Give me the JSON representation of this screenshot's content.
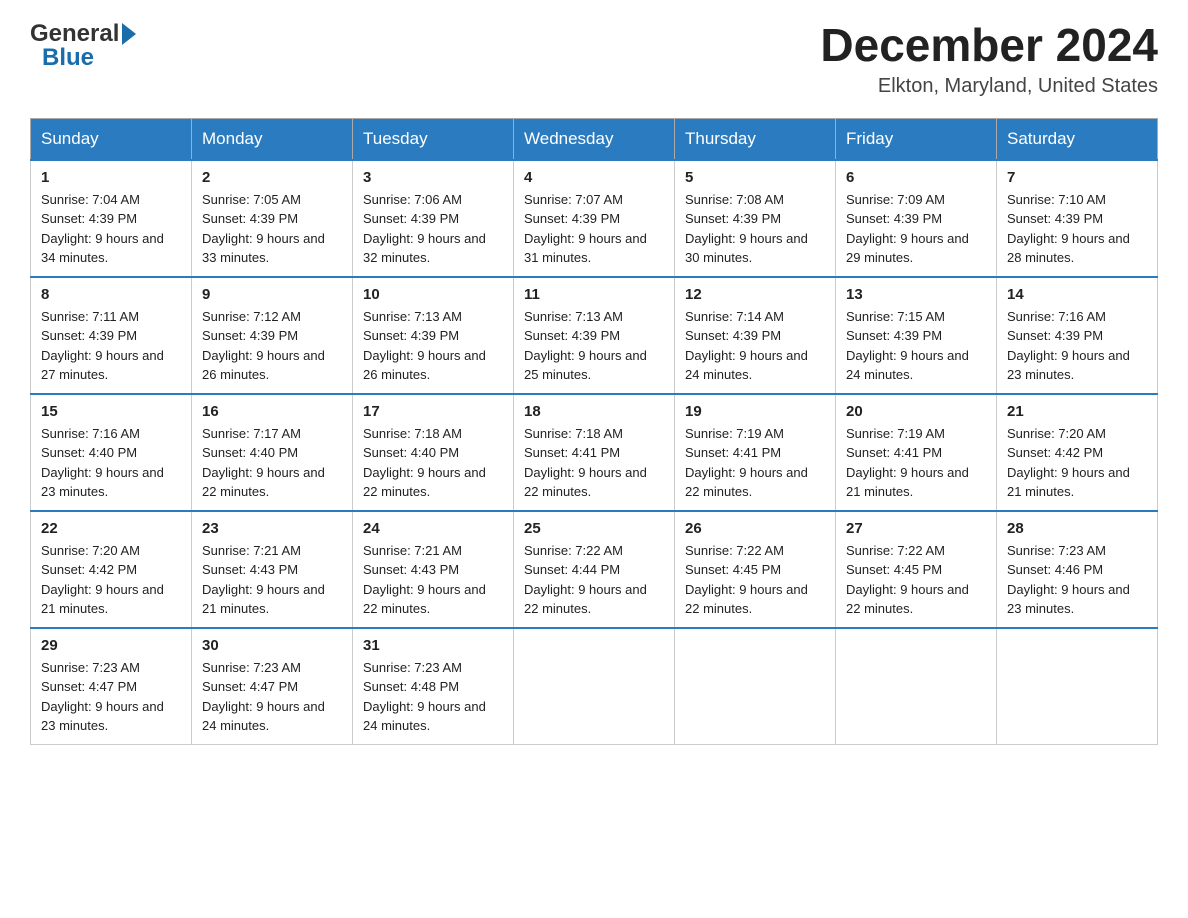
{
  "header": {
    "logo_general": "General",
    "logo_blue": "Blue",
    "month": "December 2024",
    "location": "Elkton, Maryland, United States"
  },
  "days_of_week": [
    "Sunday",
    "Monday",
    "Tuesday",
    "Wednesday",
    "Thursday",
    "Friday",
    "Saturday"
  ],
  "weeks": [
    [
      {
        "num": "1",
        "sunrise": "7:04 AM",
        "sunset": "4:39 PM",
        "daylight": "9 hours and 34 minutes."
      },
      {
        "num": "2",
        "sunrise": "7:05 AM",
        "sunset": "4:39 PM",
        "daylight": "9 hours and 33 minutes."
      },
      {
        "num": "3",
        "sunrise": "7:06 AM",
        "sunset": "4:39 PM",
        "daylight": "9 hours and 32 minutes."
      },
      {
        "num": "4",
        "sunrise": "7:07 AM",
        "sunset": "4:39 PM",
        "daylight": "9 hours and 31 minutes."
      },
      {
        "num": "5",
        "sunrise": "7:08 AM",
        "sunset": "4:39 PM",
        "daylight": "9 hours and 30 minutes."
      },
      {
        "num": "6",
        "sunrise": "7:09 AM",
        "sunset": "4:39 PM",
        "daylight": "9 hours and 29 minutes."
      },
      {
        "num": "7",
        "sunrise": "7:10 AM",
        "sunset": "4:39 PM",
        "daylight": "9 hours and 28 minutes."
      }
    ],
    [
      {
        "num": "8",
        "sunrise": "7:11 AM",
        "sunset": "4:39 PM",
        "daylight": "9 hours and 27 minutes."
      },
      {
        "num": "9",
        "sunrise": "7:12 AM",
        "sunset": "4:39 PM",
        "daylight": "9 hours and 26 minutes."
      },
      {
        "num": "10",
        "sunrise": "7:13 AM",
        "sunset": "4:39 PM",
        "daylight": "9 hours and 26 minutes."
      },
      {
        "num": "11",
        "sunrise": "7:13 AM",
        "sunset": "4:39 PM",
        "daylight": "9 hours and 25 minutes."
      },
      {
        "num": "12",
        "sunrise": "7:14 AM",
        "sunset": "4:39 PM",
        "daylight": "9 hours and 24 minutes."
      },
      {
        "num": "13",
        "sunrise": "7:15 AM",
        "sunset": "4:39 PM",
        "daylight": "9 hours and 24 minutes."
      },
      {
        "num": "14",
        "sunrise": "7:16 AM",
        "sunset": "4:39 PM",
        "daylight": "9 hours and 23 minutes."
      }
    ],
    [
      {
        "num": "15",
        "sunrise": "7:16 AM",
        "sunset": "4:40 PM",
        "daylight": "9 hours and 23 minutes."
      },
      {
        "num": "16",
        "sunrise": "7:17 AM",
        "sunset": "4:40 PM",
        "daylight": "9 hours and 22 minutes."
      },
      {
        "num": "17",
        "sunrise": "7:18 AM",
        "sunset": "4:40 PM",
        "daylight": "9 hours and 22 minutes."
      },
      {
        "num": "18",
        "sunrise": "7:18 AM",
        "sunset": "4:41 PM",
        "daylight": "9 hours and 22 minutes."
      },
      {
        "num": "19",
        "sunrise": "7:19 AM",
        "sunset": "4:41 PM",
        "daylight": "9 hours and 22 minutes."
      },
      {
        "num": "20",
        "sunrise": "7:19 AM",
        "sunset": "4:41 PM",
        "daylight": "9 hours and 21 minutes."
      },
      {
        "num": "21",
        "sunrise": "7:20 AM",
        "sunset": "4:42 PM",
        "daylight": "9 hours and 21 minutes."
      }
    ],
    [
      {
        "num": "22",
        "sunrise": "7:20 AM",
        "sunset": "4:42 PM",
        "daylight": "9 hours and 21 minutes."
      },
      {
        "num": "23",
        "sunrise": "7:21 AM",
        "sunset": "4:43 PM",
        "daylight": "9 hours and 21 minutes."
      },
      {
        "num": "24",
        "sunrise": "7:21 AM",
        "sunset": "4:43 PM",
        "daylight": "9 hours and 22 minutes."
      },
      {
        "num": "25",
        "sunrise": "7:22 AM",
        "sunset": "4:44 PM",
        "daylight": "9 hours and 22 minutes."
      },
      {
        "num": "26",
        "sunrise": "7:22 AM",
        "sunset": "4:45 PM",
        "daylight": "9 hours and 22 minutes."
      },
      {
        "num": "27",
        "sunrise": "7:22 AM",
        "sunset": "4:45 PM",
        "daylight": "9 hours and 22 minutes."
      },
      {
        "num": "28",
        "sunrise": "7:23 AM",
        "sunset": "4:46 PM",
        "daylight": "9 hours and 23 minutes."
      }
    ],
    [
      {
        "num": "29",
        "sunrise": "7:23 AM",
        "sunset": "4:47 PM",
        "daylight": "9 hours and 23 minutes."
      },
      {
        "num": "30",
        "sunrise": "7:23 AM",
        "sunset": "4:47 PM",
        "daylight": "9 hours and 24 minutes."
      },
      {
        "num": "31",
        "sunrise": "7:23 AM",
        "sunset": "4:48 PM",
        "daylight": "9 hours and 24 minutes."
      },
      null,
      null,
      null,
      null
    ]
  ]
}
